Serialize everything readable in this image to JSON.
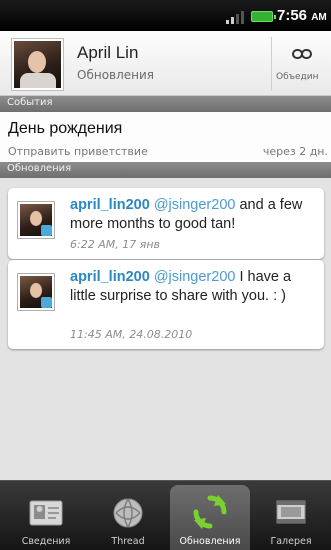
{
  "status": {
    "time": "7:56",
    "ampm": "AM"
  },
  "header": {
    "name": "April Lin",
    "subtitle": "Обновления",
    "link_label": "Объедин"
  },
  "events": {
    "section_title": "События",
    "title": "День рождения",
    "action": "Отправить приветствие",
    "when": "через 2 дн."
  },
  "updates": {
    "section_title": "Обновления",
    "items": [
      {
        "user": "april_lin200",
        "mention": "@jsinger200",
        "text": " and a few more months to good tan!",
        "time": "6:22 AM, 17 янв"
      },
      {
        "user": "april_lin200",
        "mention": "@jsinger200",
        "text": " I have a little surprise to share with you. : )",
        "time": "11:45 AM, 24.08.2010"
      }
    ]
  },
  "tabs": [
    {
      "label": "Сведения",
      "icon": "contact-card-icon"
    },
    {
      "label": "Thread",
      "icon": "thread-icon"
    },
    {
      "label": "Обновления",
      "icon": "refresh-icon",
      "active": true
    },
    {
      "label": "Галерея",
      "icon": "gallery-icon"
    }
  ],
  "colors": {
    "accent_link": "#2b88c2",
    "battery": "#36b233",
    "active_icon": "#7bd032"
  }
}
